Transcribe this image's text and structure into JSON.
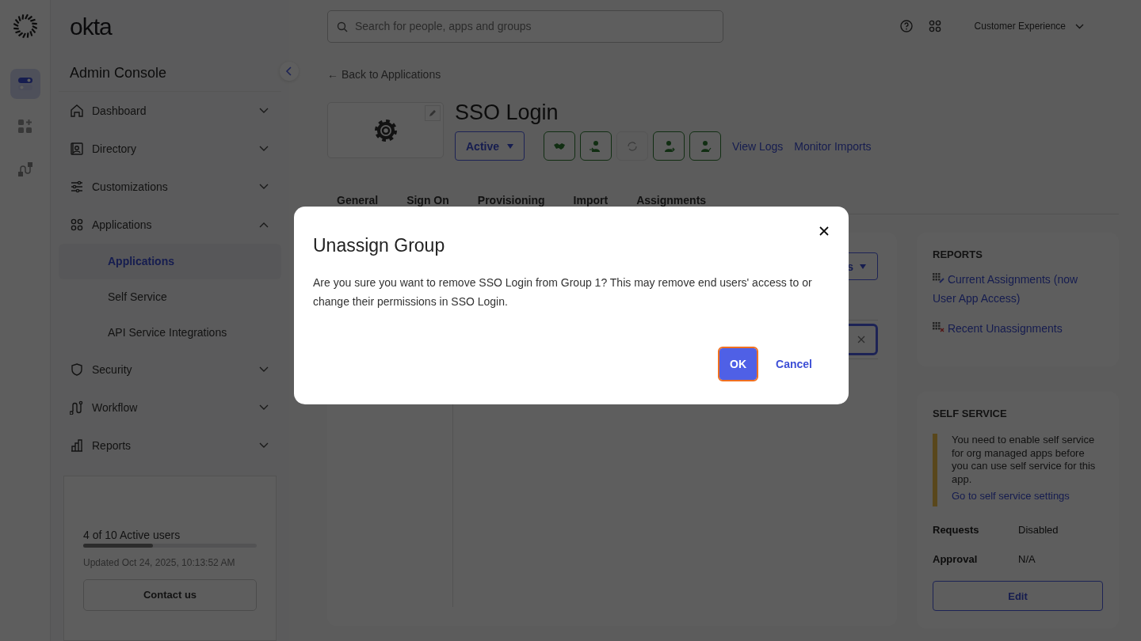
{
  "rail": {
    "items": [
      {
        "kind": "toggles",
        "selected": true
      },
      {
        "kind": "apps-add",
        "selected": false
      },
      {
        "kind": "flow",
        "selected": false
      }
    ]
  },
  "brand": {
    "wordmark": "okta"
  },
  "sidebar": {
    "title": "Admin Console",
    "items": [
      {
        "label": "Dashboard",
        "expanded": false
      },
      {
        "label": "Directory",
        "expanded": false
      },
      {
        "label": "Customizations",
        "expanded": false
      },
      {
        "label": "Applications",
        "expanded": true,
        "children": [
          {
            "label": "Applications",
            "selected": true
          },
          {
            "label": "Self Service",
            "selected": false
          },
          {
            "label": "API Service Integrations",
            "selected": false
          }
        ]
      },
      {
        "label": "Security",
        "expanded": false
      },
      {
        "label": "Workflow",
        "expanded": false
      },
      {
        "label": "Reports",
        "expanded": false
      }
    ]
  },
  "usage": {
    "label": "4 of 10 Active users",
    "level": 0.4,
    "updated": "Updated Oct 24, 2025, 10:13:52 AM",
    "button": "Contact us"
  },
  "topbar": {
    "search": {
      "placeholder": "Search for people, apps and groups"
    },
    "org": "Customer Experience"
  },
  "back_link": "← Back to Applications",
  "app": {
    "name": "SSO Login",
    "status": "Active",
    "actions": [
      {
        "kind": "handshake",
        "disabled": false
      },
      {
        "kind": "user-in",
        "disabled": false
      },
      {
        "kind": "refresh",
        "disabled": true
      },
      {
        "kind": "user-out",
        "disabled": false
      },
      {
        "kind": "user-check",
        "disabled": false
      }
    ],
    "links": [
      "View Logs",
      "Monitor Imports"
    ]
  },
  "tabs": [
    {
      "label": "General"
    },
    {
      "label": "Sign On"
    },
    {
      "label": "Provisioning"
    },
    {
      "label": "Import"
    },
    {
      "label": "Assignments"
    }
  ],
  "assignments": {
    "menu_button": "s"
  },
  "reports": {
    "title": "REPORTS",
    "links": [
      {
        "label": "Current Assignments (now User App Access)",
        "kind": "current"
      },
      {
        "label": "Recent Unassignments",
        "kind": "removed"
      }
    ]
  },
  "self_service": {
    "title": "SELF SERVICE",
    "notice": "You need to enable self service for org managed apps before you can use self service for this app.",
    "notice_link": "Go to self service settings",
    "fields": [
      {
        "label": "Requests",
        "value": "Disabled"
      },
      {
        "label": "Approval",
        "value": "N/A"
      }
    ],
    "button": "Edit"
  },
  "dialog": {
    "title": "Unassign Group",
    "message": "Are you sure you want to remove SSO Login from Group 1? This may remove end users' access to or change their permissions in SSO Login.",
    "buttons": [
      {
        "label": "OK",
        "kind": "primary",
        "focused": true
      },
      {
        "label": "Cancel",
        "kind": "link",
        "focused": false
      }
    ]
  }
}
